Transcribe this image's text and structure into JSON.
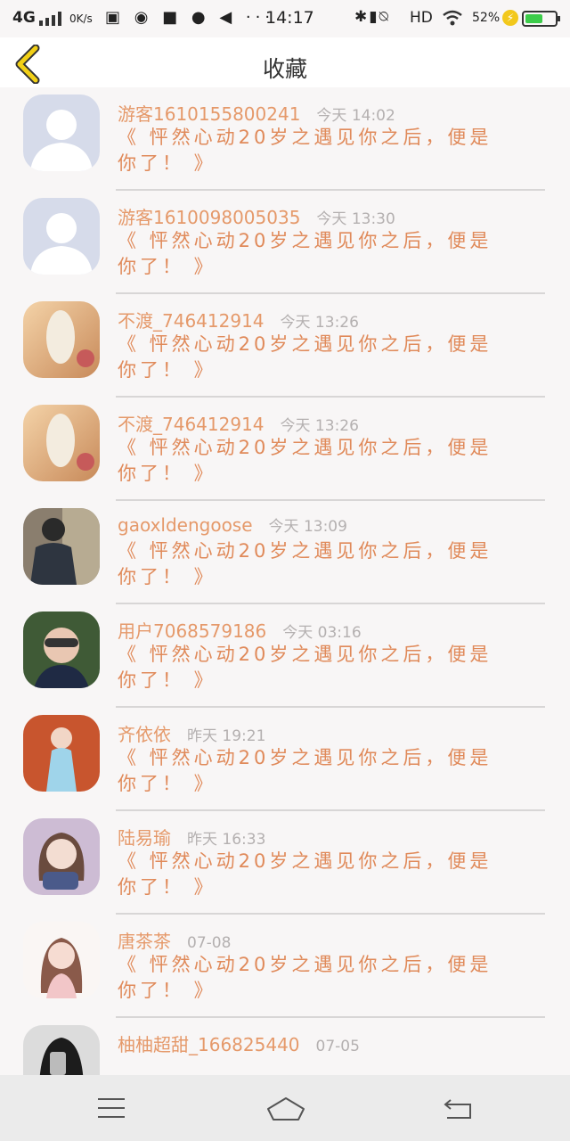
{
  "status_bar": {
    "signal": "4G",
    "speed": "0K/s",
    "time": "14:17",
    "right_icons": "HD",
    "battery": "52%"
  },
  "header": {
    "title": "收藏"
  },
  "items": [
    {
      "name": "游客1610155800241",
      "time": "今天 14:02",
      "message": "《 怦然心动20岁之遇见你之后，便是你了！ 》"
    },
    {
      "name": "游客1610098005035",
      "time": "今天 13:30",
      "message": "《 怦然心动20岁之遇见你之后，便是你了！ 》"
    },
    {
      "name": "不渡_746412914",
      "time": "今天 13:26",
      "message": "《 怦然心动20岁之遇见你之后，便是你了！ 》"
    },
    {
      "name": "不渡_746412914",
      "time": "今天 13:26",
      "message": "《 怦然心动20岁之遇见你之后，便是你了！ 》"
    },
    {
      "name": "gaoxldengoose",
      "time": "今天 13:09",
      "message": "《 怦然心动20岁之遇见你之后，便是你了！ 》"
    },
    {
      "name": "用户7068579186",
      "time": "今天 03:16",
      "message": "《 怦然心动20岁之遇见你之后，便是你了！ 》"
    },
    {
      "name": "齐依依",
      "time": "昨天 19:21",
      "message": "《 怦然心动20岁之遇见你之后，便是你了！ 》"
    },
    {
      "name": "陆易瑜",
      "time": "昨天 16:33",
      "message": "《 怦然心动20岁之遇见你之后，便是你了！ 》"
    },
    {
      "name": "唐茶茶",
      "time": "07-08",
      "message": "《 怦然心动20岁之遇见你之后，便是你了！ 》"
    },
    {
      "name": "柚柚超甜_166825440",
      "time": "07-05",
      "message": ""
    }
  ],
  "colors": {
    "accent": "#e08a5a",
    "back_icon": "#f2d016"
  }
}
